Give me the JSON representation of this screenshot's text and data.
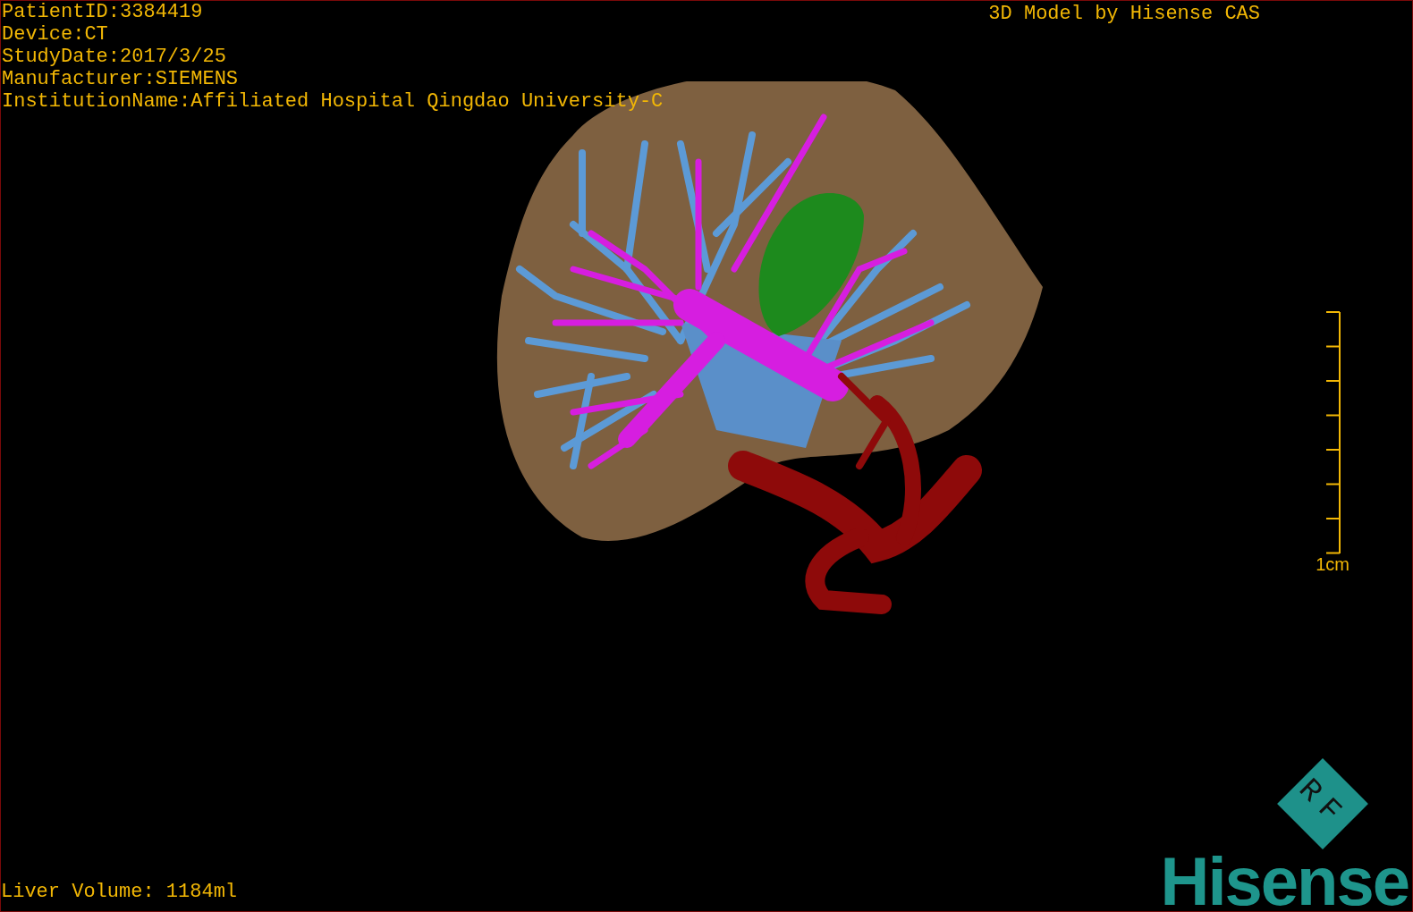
{
  "patient_info": [
    "PatientID:3384419",
    "Device:CT",
    "StudyDate:2017/3/25",
    "Manufacturer:SIEMENS",
    "InstitutionName:Affiliated Hospital Qingdao University-C"
  ],
  "title": "3D Model by Hisense CAS",
  "scale_bar": {
    "label": "1cm"
  },
  "liver_volume": "Liver Volume: 1184ml",
  "logo": {
    "badge": "RF",
    "wordmark": "Hisense"
  }
}
